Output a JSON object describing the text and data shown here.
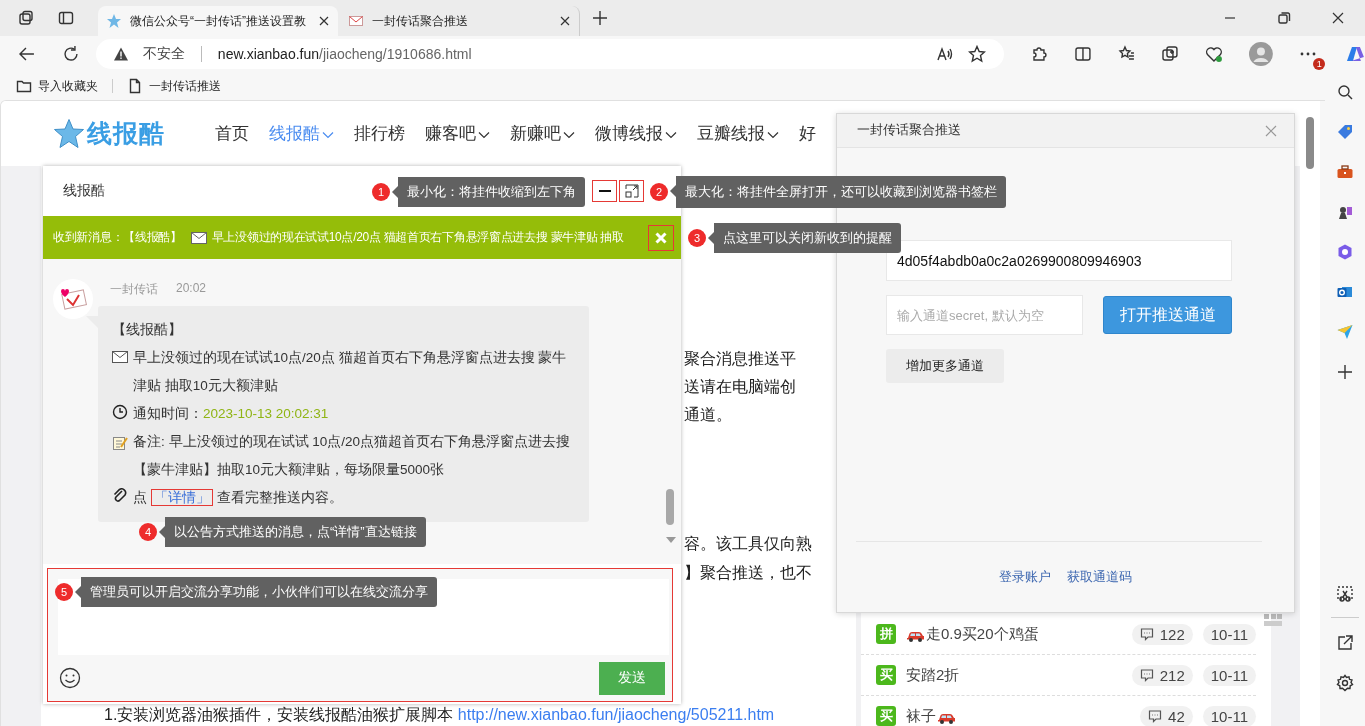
{
  "browser": {
    "tabs": [
      {
        "title": "微信公众号“一封传话”推送设置教",
        "selected": true
      },
      {
        "title": "一封传话聚合推送",
        "selected": false
      }
    ],
    "security": "不安全",
    "url_host": "new.xianbao.fun",
    "url_path": "/jiaocheng/1910686.html",
    "notification_count": "1",
    "bookmarks": [
      {
        "kind": "folder",
        "label": "导入收藏夹"
      },
      {
        "kind": "page",
        "label": "一封传话推送"
      }
    ]
  },
  "site": {
    "logo": "线报酷",
    "nav": [
      {
        "label": "首页",
        "selected": false,
        "dropdown": false
      },
      {
        "label": "线报酷",
        "selected": true,
        "dropdown": true
      },
      {
        "label": "排行榜",
        "selected": false,
        "dropdown": false
      },
      {
        "label": "赚客吧",
        "selected": false,
        "dropdown": true
      },
      {
        "label": "新赚吧",
        "selected": false,
        "dropdown": true
      },
      {
        "label": "微博线报",
        "selected": false,
        "dropdown": true
      },
      {
        "label": "豆瓣线报",
        "selected": false,
        "dropdown": true
      },
      {
        "label": "好",
        "selected": false,
        "dropdown": false
      }
    ]
  },
  "article": {
    "paragraphs": [
      [
        "聚合消息推送平",
        "送请在电脑端创",
        "通道。"
      ],
      [
        "容。该工具仅向熟",
        "】聚合推送，也不"
      ]
    ],
    "step": {
      "text": "1.安装浏览器油猴插件，安装线报酷油猴扩展脚本 ",
      "link": "http://new.xianbao.fun/jiaocheng/505211.htm"
    }
  },
  "deals": [
    {
      "tag": "拼",
      "title": "走0.9买20个鸡蛋",
      "car_before": true,
      "car_after": false,
      "comments": "122",
      "date": "10-11"
    },
    {
      "tag": "买",
      "title": "安踏2折",
      "car_before": false,
      "car_after": false,
      "comments": "212",
      "date": "10-11"
    },
    {
      "tag": "买",
      "title": "袜子",
      "car_before": false,
      "car_after": true,
      "comments": "42",
      "date": "10-11"
    }
  ],
  "chat_widget": {
    "title": "线报酷",
    "banner": {
      "label": "收到新消息：【线报酷】",
      "text": "早上没领过的现在试试10点/20点 猫超首页右下角悬浮窗点进去搜 蒙牛津贴 抽取"
    },
    "message": {
      "sender": "一封传话",
      "time": "20:02",
      "heading": "【线报酷】",
      "body": "早上没领过的现在试试10点/20点 猫超首页右下角悬浮窗点进去搜 蒙牛津贴 抽取10元大额津贴",
      "time_label": "通知时间：",
      "time_value": "2023-10-13 20:02:31",
      "note": "备注: 早上没领过的现在试试 10点/20点猫超首页右下角悬浮窗点进去搜【蒙牛津贴】抽取10元大额津贴，每场限量5000张",
      "link_prefix": "点",
      "link": "「详情」",
      "link_suffix": "查看完整推送内容。"
    },
    "send_button": "发送"
  },
  "annotations": [
    {
      "number": "1",
      "text": "最小化：将挂件收缩到左下角"
    },
    {
      "number": "2",
      "text": "最大化：将挂件全屏打开，还可以收藏到浏览器书签栏"
    },
    {
      "number": "3",
      "text": "点这里可以关闭新收到的提醒"
    },
    {
      "number": "4",
      "text": "以公告方式推送的消息，点“详情”直达链接"
    },
    {
      "number": "5",
      "text": "管理员可以开启交流分享功能，小伙伴们可以在线交流分享"
    }
  ],
  "push_panel": {
    "title": "一封传话聚合推送",
    "token": "4d05f4abdb0a0c2a0269900809946903",
    "secret_placeholder": "输入通道secret, 默认为空",
    "open_button": "打开推送通道",
    "add_button": "增加更多通道",
    "links": [
      "登录账户",
      "获取通道码"
    ]
  }
}
